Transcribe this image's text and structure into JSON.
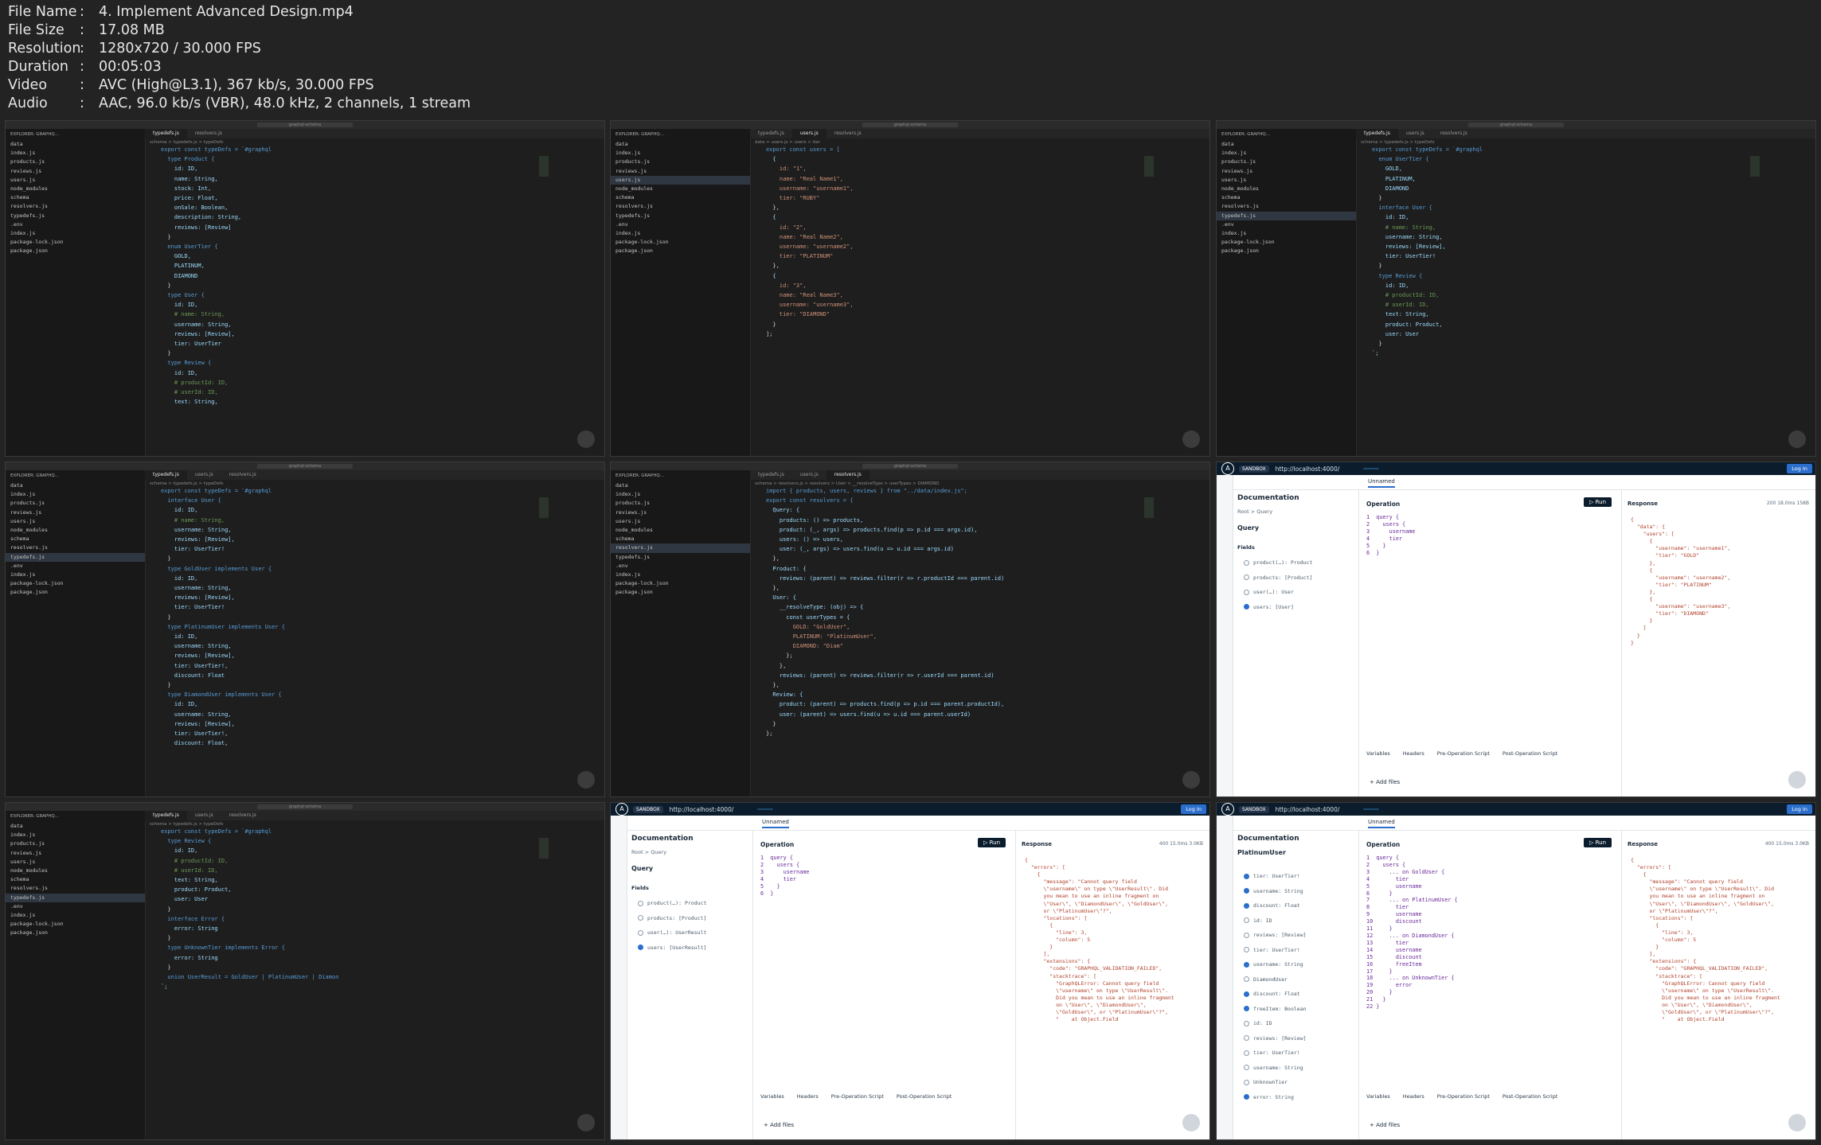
{
  "info": [
    {
      "key": "File Name",
      "value": "4. Implement Advanced Design.mp4"
    },
    {
      "key": "File Size",
      "value": "17.08 MB"
    },
    {
      "key": "Resolution",
      "value": "1280x720 / 30.000 FPS"
    },
    {
      "key": "Duration",
      "value": "00:05:03"
    },
    {
      "key": "Video",
      "value": "AVC (High@L3.1), 367 kb/s, 30.000 FPS"
    },
    {
      "key": "Audio",
      "value": "AAC, 96.0 kb/s (VBR), 48.0 kHz, 2 channels, 1 stream"
    }
  ],
  "info_sep": ":",
  "vscode": {
    "search": "graphql-schema",
    "explorer_title": "EXPLORER: GRAPHQ...",
    "files": [
      "data",
      "index.js",
      "products.js",
      "reviews.js",
      "users.js",
      "node_modules",
      "schema",
      "resolvers.js",
      "typedefs.js",
      ".env",
      "index.js",
      "package-lock.json",
      "package.json"
    ]
  },
  "thumbs": [
    {
      "tabs": [
        "typedefs.js",
        "resolvers.js"
      ],
      "active_tab": 0,
      "breadcrumb": "schema > typedefs.js > typeDefs",
      "selected_file": -1,
      "code": [
        "export const typeDefs = `#graphql",
        "",
        "  type Product {",
        "    id: ID,",
        "    name: String,",
        "    stock: Int,",
        "    price: Float,",
        "    onSale: Boolean,",
        "    description: String,",
        "    reviews: [Review]",
        "  }",
        "",
        "  enum UserTier {",
        "    GOLD,",
        "    PLATINUM,",
        "    DIAMOND",
        "  }",
        "",
        "  type User {",
        "    id: ID,",
        "    # name: String,",
        "    username: String,",
        "    reviews: [Review],",
        "    tier: UserTier",
        "  }",
        "",
        "  type Review {",
        "    id: ID,",
        "    # productId: ID,",
        "    # userId: ID,",
        "    text: String,"
      ]
    },
    {
      "tabs": [
        "typedefs.js",
        "users.js",
        "resolvers.js"
      ],
      "active_tab": 1,
      "breadcrumb": "data > users.js > users > tier",
      "selected_file": 4,
      "code": [
        "export const users = [",
        "  {",
        "    id: \"1\",",
        "    name: \"Real Name1\",",
        "    username: \"username1\",",
        "    tier: \"RUBY\"",
        "  },",
        "  {",
        "    id: \"2\",",
        "    name: \"Real Name2\",",
        "    username: \"username2\",",
        "    tier: \"PLATINUM\"",
        "  },",
        "  {",
        "    id: \"3\",",
        "    name: \"Real Name3\",",
        "    username: \"username3\",",
        "    tier: \"DIAMOND\"",
        "  }",
        "];"
      ]
    },
    {
      "tabs": [
        "typedefs.js",
        "users.js",
        "resolvers.js"
      ],
      "active_tab": 0,
      "breadcrumb": "schema > typedefs.js > typeDefs",
      "selected_file": 8,
      "code": [
        "export const typeDefs = `#graphql",
        "  enum UserTier {",
        "    GOLD,",
        "    PLATINUM,",
        "    DIAMOND",
        "  }",
        "",
        "  interface User {",
        "    id: ID,",
        "    # name: String,",
        "    username: String,",
        "    reviews: [Review],",
        "    tier: UserTier!",
        "  }",
        "",
        "  type Review {",
        "    id: ID,",
        "    # productId: ID,",
        "    # userId: ID,",
        "    text: String,",
        "    product: Product,",
        "    user: User",
        "  }",
        "`;"
      ]
    },
    {
      "tabs": [
        "typedefs.js",
        "users.js",
        "resolvers.js"
      ],
      "active_tab": 0,
      "breadcrumb": "schema > typedefs.js > typeDefs",
      "selected_file": 8,
      "code": [
        "export const typeDefs = `#graphql",
        "",
        "  interface User {",
        "    id: ID,",
        "    # name: String,",
        "    username: String,",
        "    reviews: [Review],",
        "    tier: UserTier!",
        "  }",
        "",
        "  type GoldUser implements User {",
        "    id: ID,",
        "    username: String,",
        "    reviews: [Review],",
        "    tier: UserTier!",
        "  }",
        "",
        "  type PlatinumUser implements User {",
        "    id: ID,",
        "    username: String,",
        "    reviews: [Review],",
        "    tier: UserTier!,",
        "    discount: Float",
        "  }",
        "",
        "  type DiamondUser implements User {",
        "    id: ID,",
        "    username: String,",
        "    reviews: [Review],",
        "    tier: UserTier!,",
        "    discount: Float,"
      ]
    },
    {
      "tabs": [
        "typedefs.js",
        "users.js",
        "resolvers.js"
      ],
      "active_tab": 2,
      "breadcrumb": "schema > resolvers.js > resolvers > User > __resolveType > userTypes > DIAMOND",
      "selected_file": 7,
      "code": [
        "import { products, users, reviews } from \"../data/index.js\";",
        "",
        "export const resolvers = {",
        "  Query: {",
        "    products: () => products,",
        "    product: (_, args) => products.find(p => p.id === args.id),",
        "    users: () => users,",
        "    user: (_, args) => users.find(u => u.id === args.id)",
        "  },",
        "  Product: {",
        "    reviews: (parent) => reviews.filter(r => r.productId === parent.id)",
        "  },",
        "  User: {",
        "    __resolveType: (obj) => {",
        "      const userTypes = {",
        "        GOLD: \"GoldUser\",",
        "        PLATINUM: \"PlatinumUser\",",
        "        DIAMOND: \"Diam\"",
        "      };",
        "    },",
        "    reviews: (parent) => reviews.filter(r => r.userId === parent.id)",
        "  },",
        "  Review: {",
        "    product: (parent) => products.find(p => p.id === parent.productId),",
        "    user: (parent) => users.find(u => u.id === parent.userId)",
        "  }",
        "};"
      ]
    },
    {
      "type": "apollo",
      "sandbox": "SANDBOX",
      "url": "http://localhost:4000/",
      "login": "Log In",
      "tab": "Unnamed",
      "run": "Run",
      "doc_title": "Documentation",
      "breadcrumb": "Root > Query",
      "query_label": "Query",
      "fields_label": "Fields",
      "fields": [
        {
          "t": "product(…): Product",
          "on": false
        },
        {
          "t": "products: [Product]",
          "on": false
        },
        {
          "t": "user(…): User",
          "on": false
        },
        {
          "t": "users: [User]",
          "on": true
        }
      ],
      "operation": [
        "1  query {",
        "2    users {",
        "3      username",
        "4      tier",
        "5    }",
        "6  }"
      ],
      "response_label": "Response",
      "response_stats": "200  18.0ms  158B",
      "response": [
        "{",
        "  \"data\": {",
        "    \"users\": [",
        "      {",
        "        \"username\": \"username1\",",
        "        \"tier\": \"GOLD\"",
        "      },",
        "      {",
        "        \"username\": \"username2\",",
        "        \"tier\": \"PLATINUM\"",
        "      },",
        "      {",
        "        \"username\": \"username3\",",
        "        \"tier\": \"DIAMOND\"",
        "      }",
        "    ]",
        "  }",
        "}"
      ],
      "var_tabs": [
        "Variables",
        "Headers",
        "Pre-Operation Script",
        "Post-Operation Script"
      ],
      "add_files": "+ Add files"
    },
    {
      "tabs": [
        "typedefs.js",
        "users.js",
        "resolvers.js"
      ],
      "active_tab": 0,
      "breadcrumb": "schema > typedefs.js > typeDefs",
      "selected_file": 8,
      "code": [
        "export const typeDefs = `#graphql",
        "",
        "  type Review {",
        "    id: ID,",
        "    # productId: ID,",
        "    # userId: ID,",
        "    text: String,",
        "    product: Product,",
        "    user: User",
        "  }",
        "",
        "  interface Error {",
        "    error: String",
        "  }",
        "",
        "  type UnknownTier implements Error {",
        "    error: String",
        "  }",
        "",
        "  union UserResult = GoldUser | PlatinumUser | Diamon",
        "`;"
      ]
    },
    {
      "type": "apollo",
      "sandbox": "SANDBOX",
      "url": "http://localhost:4000/",
      "login": "Log In",
      "tab": "Unnamed",
      "run": "Run",
      "doc_title": "Documentation",
      "breadcrumb": "Root > Query",
      "query_label": "Query",
      "fields_label": "Fields",
      "fields": [
        {
          "t": "product(…): Product",
          "on": false
        },
        {
          "t": "products: [Product]",
          "on": false
        },
        {
          "t": "user(…): UserResult",
          "on": false
        },
        {
          "t": "users: [UserResult]",
          "on": true
        }
      ],
      "operation": [
        "1  query {",
        "2    users {",
        "3      username",
        "4      tier",
        "5    }",
        "6  }"
      ],
      "response_label": "Response",
      "response_stats": "400  15.0ms  3.0KB",
      "response": [
        "{",
        "  \"errors\": [",
        "    {",
        "      \"message\": \"Cannot query field",
        "      \\\"username\\\" on type \\\"UserResult\\\". Did",
        "      you mean to use an inline fragment on",
        "      \\\"User\\\", \\\"DiamondUser\\\", \\\"GoldUser\\\",",
        "      or \\\"PlatinumUser\\\"?\",",
        "      \"locations\": [",
        "        {",
        "          \"line\": 3,",
        "          \"column\": 5",
        "        }",
        "      ],",
        "      \"extensions\": {",
        "        \"code\": \"GRAPHQL_VALIDATION_FAILED\",",
        "        \"stacktrace\": [",
        "          \"GraphQLError: Cannot query field",
        "          \\\"username\\\" on type \\\"UserResult\\\".",
        "          Did you mean to use an inline fragment",
        "          on \\\"User\\\", \\\"DiamondUser\\\",",
        "          \\\"GoldUser\\\", or \\\"PlatinumUser\\\"?\",",
        "          \"    at Object.Field"
      ],
      "var_tabs": [
        "Variables",
        "Headers",
        "Pre-Operation Script",
        "Post-Operation Script"
      ],
      "add_files": "+ Add files"
    },
    {
      "type": "apollo",
      "sandbox": "SANDBOX",
      "url": "http://localhost:4000/",
      "login": "Log In",
      "tab": "Unnamed",
      "run": "Run",
      "doc_title": "Documentation",
      "breadcrumb": "",
      "query_label": "PlatinumUser",
      "fields_label": "",
      "fields": [
        {
          "t": "tier: UserTier!",
          "on": true
        },
        {
          "t": "username: String",
          "on": true
        },
        {
          "t": "discount: Float",
          "on": true
        },
        {
          "t": "id: ID",
          "on": false
        },
        {
          "t": "reviews: [Review]",
          "on": false
        },
        {
          "t": "tier: UserTier!",
          "on": false
        },
        {
          "t": "username: String",
          "on": true
        },
        {
          "t": "DiamondUser",
          "on": false
        },
        {
          "t": "discount: Float",
          "on": true
        },
        {
          "t": "freeItem: Boolean",
          "on": true
        },
        {
          "t": "id: ID",
          "on": false
        },
        {
          "t": "reviews: [Review]",
          "on": false
        },
        {
          "t": "tier: UserTier!",
          "on": false
        },
        {
          "t": "username: String",
          "on": false
        },
        {
          "t": "UnknownTier",
          "on": false
        },
        {
          "t": "error: String",
          "on": true
        }
      ],
      "operation": [
        "1  query {",
        "2    users {",
        "3      ... on GoldUser {",
        "4        tier",
        "5        username",
        "6      }",
        "7      ... on PlatinumUser {",
        "8        tier",
        "9        username",
        "10       discount",
        "11     }",
        "12     ... on DiamondUser {",
        "13       tier",
        "14       username",
        "15       discount",
        "16       freeItem",
        "17     }",
        "18     ... on UnknownTier {",
        "19       error",
        "20     }",
        "21   }",
        "22 }"
      ],
      "response_label": "Response",
      "response_stats": "400  15.0ms  3.0KB",
      "response": [
        "{",
        "  \"errors\": [",
        "    {",
        "      \"message\": \"Cannot query field",
        "      \\\"username\\\" on type \\\"UserResult\\\". Did",
        "      you mean to use an inline fragment on",
        "      \\\"User\\\", \\\"DiamondUser\\\", \\\"GoldUser\\\",",
        "      or \\\"PlatinumUser\\\"?\",",
        "      \"locations\": [",
        "        {",
        "          \"line\": 3,",
        "          \"column\": 5",
        "        }",
        "      ],",
        "      \"extensions\": {",
        "        \"code\": \"GRAPHQL_VALIDATION_FAILED\",",
        "        \"stacktrace\": [",
        "          \"GraphQLError: Cannot query field",
        "          \\\"username\\\" on type \\\"UserResult\\\".",
        "          Did you mean to use an inline fragment",
        "          on \\\"User\\\", \\\"DiamondUser\\\",",
        "          \\\"GoldUser\\\", or \\\"PlatinumUser\\\"?\",",
        "          \"    at Object.Field"
      ],
      "var_tabs": [
        "Variables",
        "Headers",
        "Pre-Operation Script",
        "Post-Operation Script"
      ],
      "add_files": "+ Add files"
    }
  ]
}
